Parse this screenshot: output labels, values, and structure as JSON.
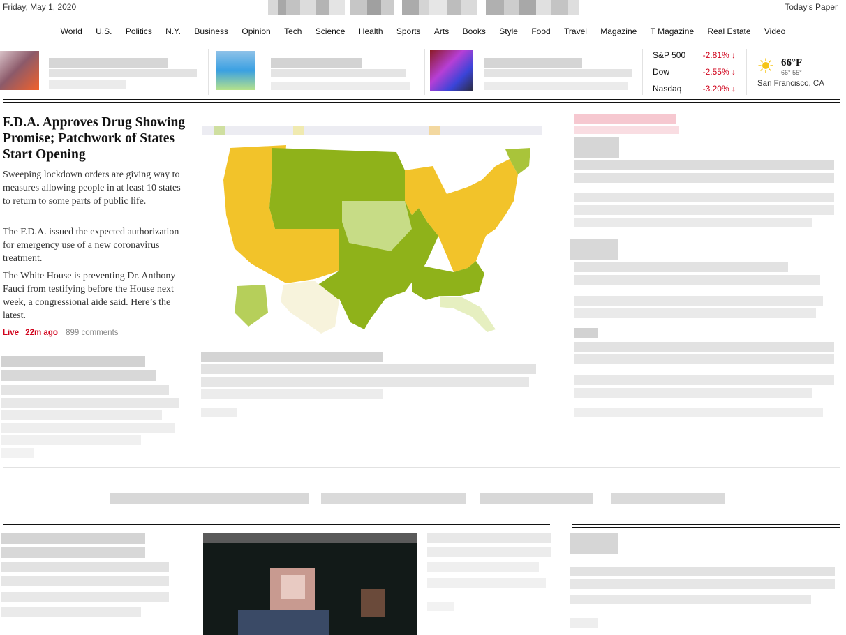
{
  "header": {
    "date": "Friday, May 1, 2020",
    "todays_paper": "Today's Paper"
  },
  "nav": {
    "items": [
      "World",
      "U.S.",
      "Politics",
      "N.Y.",
      "Business",
      "Opinion",
      "Tech",
      "Science",
      "Health",
      "Sports",
      "Arts",
      "Books",
      "Style",
      "Food",
      "Travel",
      "Magazine",
      "T Magazine",
      "Real Estate",
      "Video"
    ]
  },
  "markets": [
    {
      "name": "S&P 500",
      "change": "-2.81%",
      "direction": "down"
    },
    {
      "name": "Dow",
      "change": "-2.55%",
      "direction": "down"
    },
    {
      "name": "Nasdaq",
      "change": "-3.20%",
      "direction": "down"
    }
  ],
  "weather": {
    "temp": "66°F",
    "range": "66° 55°",
    "city": "San Francisco, CA",
    "icon": "sun-icon"
  },
  "lead": {
    "headline": "F.D.A. Approves Drug Showing Promise; Patchwork of States Start Opening",
    "summaries": [
      "Sweeping lockdown orders are giving way to measures allowing people in at least 10 states to return to some parts of public life.",
      "The F.D.A. issued the expected authorization for emergency use of a new coronavirus treatment.",
      "The White House is preventing Dr. Anthony Fauci from testifying before the House next week, a congressional aide said. Here’s the latest."
    ],
    "live": "Live",
    "time": "22m ago",
    "comments": "899 comments"
  },
  "colors": {
    "accent_red": "#d0021b",
    "rule_dark": "#121212",
    "rule_light": "#e2e2e2",
    "map_green": "#8fb21a",
    "map_yellow": "#f3c223"
  }
}
